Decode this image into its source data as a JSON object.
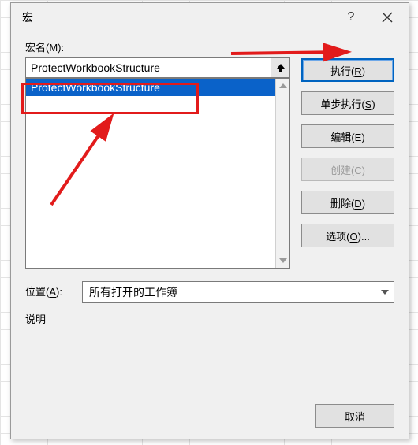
{
  "title": "宏",
  "labels": {
    "macro_name": "宏名(M):",
    "location": "位置(A):",
    "description": "说明"
  },
  "input": {
    "macro_name_value": "ProtectWorkbookStructure"
  },
  "list": {
    "items": [
      "ProtectWorkbookStructure"
    ],
    "selected_index": 0
  },
  "location": {
    "selected": "所有打开的工作簿"
  },
  "buttons": {
    "run": "执行(R)",
    "step": "单步执行(S)",
    "edit": "编辑(E)",
    "create": "创建(C)",
    "delete": "删除(D)",
    "options": "选项(O)...",
    "cancel": "取消"
  },
  "accelerators": {
    "run": "R",
    "step": "S",
    "edit": "E",
    "delete": "D",
    "options": "O",
    "macro_name": "M",
    "location": "A"
  },
  "colors": {
    "selection": "#0a62c9",
    "annotation": "#e21b1b",
    "primary_border": "#0064c0"
  }
}
